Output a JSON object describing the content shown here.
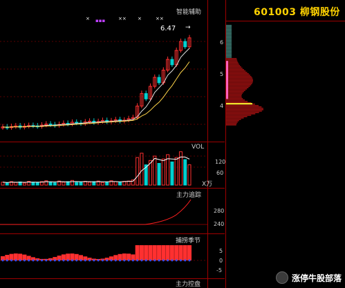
{
  "title": "601003 柳钢股份",
  "panels": {
    "main": {
      "label": "智能辅助",
      "peak_label": "6.47",
      "arrow": "→",
      "x_marks": [
        "×",
        "▪▪▪",
        "××",
        "×",
        "××"
      ]
    },
    "vol": {
      "label": "VOL",
      "ticks": [
        "120",
        "60"
      ],
      "unit": "X万"
    },
    "track": {
      "label": "主力追踪",
      "ticks": [
        "280",
        "240"
      ]
    },
    "season": {
      "label": "捕捞季节",
      "ticks": [
        "5",
        "0",
        "-5"
      ]
    },
    "control": {
      "label": "主力控盘"
    }
  },
  "profile_ticks": [
    "6",
    "5",
    "4"
  ],
  "watermark": "涨停牛股部落",
  "colors": {
    "up": "#ff3030",
    "down": "#00d0d0",
    "ma1": "#ffd54a",
    "ma2": "#e0e0e0",
    "grid": "#a00000"
  },
  "chart_data": {
    "type": "candlestick",
    "close": [
      3.82,
      3.8,
      3.83,
      3.85,
      3.81,
      3.84,
      3.86,
      3.85,
      3.83,
      3.87,
      3.9,
      3.88,
      3.86,
      3.89,
      3.92,
      3.9,
      3.95,
      3.93,
      3.91,
      3.96,
      3.98,
      3.94,
      3.97,
      4.0,
      3.96,
      3.99,
      4.02,
      3.98,
      4.01,
      4.05,
      4.08,
      4.4,
      4.75,
      4.6,
      4.95,
      5.2,
      5.05,
      5.4,
      5.7,
      5.55,
      5.95,
      6.2,
      6.05,
      6.3
    ],
    "volume": [
      10,
      8,
      12,
      9,
      11,
      7,
      13,
      10,
      9,
      12,
      15,
      11,
      8,
      14,
      10,
      12,
      16,
      9,
      11,
      13,
      10,
      12,
      14,
      9,
      11,
      15,
      12,
      10,
      13,
      14,
      18,
      95,
      110,
      70,
      85,
      100,
      75,
      90,
      105,
      80,
      95,
      115,
      88,
      70
    ],
    "profile_ticks": [
      6,
      5,
      4
    ],
    "profile_current": 4.45
  }
}
